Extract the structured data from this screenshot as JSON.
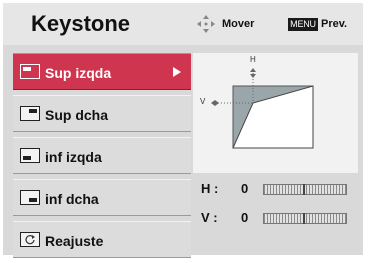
{
  "header": {
    "title": "Keystone",
    "mover_label": "Mover",
    "menu_key_label": "MENU",
    "prev_label": "Prev."
  },
  "menu": {
    "items": [
      {
        "label": "Sup izqda",
        "selected": true,
        "icon": "keystone-top-left-icon"
      },
      {
        "label": "Sup dcha",
        "selected": false,
        "icon": "keystone-top-right-icon"
      },
      {
        "label": "inf izqda",
        "selected": false,
        "icon": "keystone-bottom-left-icon"
      },
      {
        "label": "inf dcha",
        "selected": false,
        "icon": "keystone-bottom-right-icon"
      },
      {
        "label": "Reajuste",
        "selected": false,
        "icon": "reset-icon"
      }
    ]
  },
  "preview": {
    "h_marker": "H",
    "v_marker": "V"
  },
  "values": {
    "h_label": "H :",
    "h_value": "0",
    "h_slider_level": 0.5,
    "v_label": "V :",
    "v_value": "0",
    "v_slider_level": 0.5
  },
  "colors": {
    "selected": "#d0354f",
    "panel": "#d9d9d9",
    "header": "#e6e6e6"
  }
}
